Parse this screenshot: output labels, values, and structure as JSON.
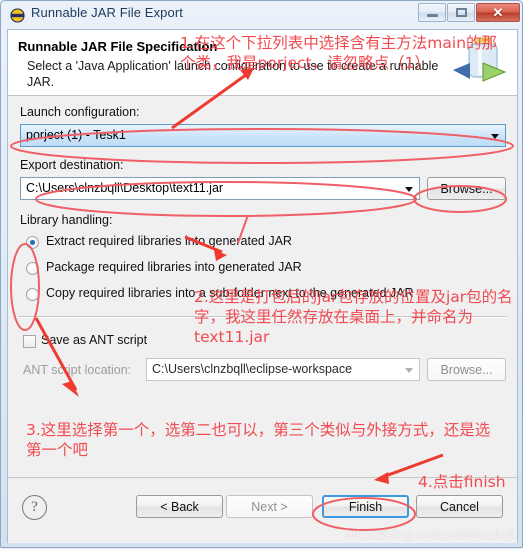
{
  "window": {
    "title": "Runnable JAR File Export",
    "icon": "jar-export-icon",
    "buttons": {
      "minimize": "minimize-icon",
      "maximize": "maximize-icon",
      "close": "✕"
    }
  },
  "header": {
    "title": "Runnable JAR File Specification",
    "description": "Select a 'Java Application' launch configuration to use to create a runnable JAR.",
    "icon": "jar-wizard-banner-icon"
  },
  "form": {
    "launch_configuration_label": "Launch configuration:",
    "launch_configuration_value": "porject (1) - Tesk1",
    "export_destination_label": "Export destination:",
    "export_destination_value": "C:\\Users\\clnzbqll\\Desktop\\text11.jar",
    "browse_destination_label": "Browse...",
    "library_handling_label": "Library handling:",
    "library_options": [
      {
        "label": "Extract required libraries into generated JAR",
        "selected": true
      },
      {
        "label": "Package required libraries into generated JAR",
        "selected": false
      },
      {
        "label": "Copy required libraries into a sub-folder next to the generated JAR",
        "selected": false
      }
    ],
    "save_ant_label": "Save as ANT script",
    "save_ant_checked": false,
    "ant_location_label": "ANT script location:",
    "ant_location_value": "C:\\Users\\clnzbqll\\eclipse-workspace",
    "browse_ant_label": "Browse..."
  },
  "footer": {
    "help_label": "?",
    "back_label": "< Back",
    "next_label": "Next >",
    "finish_label": "Finish",
    "cancel_label": "Cancel"
  },
  "annotations": [
    {
      "id": "annotation-1",
      "text": "1.在这个下拉列表中选择含有主方法main的那\n个类，我是porject，请忽略点（1）"
    },
    {
      "id": "annotation-2",
      "text": "2.这里是打包后的jar包存放的位置及jar包的名\n字，我这里任然存放在桌面上，并命名为\ntext11.jar"
    },
    {
      "id": "annotation-3",
      "text": "3.这里选择第一个，选第二也可以，第三个类似与外接方式，还是选\n第一个吧"
    },
    {
      "id": "annotation-4",
      "text": "4.点击finish"
    }
  ],
  "watermark": "https://blog.csdn.net/clnzbqll",
  "colors": {
    "annotation_red": "#f04b52",
    "accent_blue": "#5c9ccc",
    "titlebar_blue": "#1f3a5f"
  }
}
